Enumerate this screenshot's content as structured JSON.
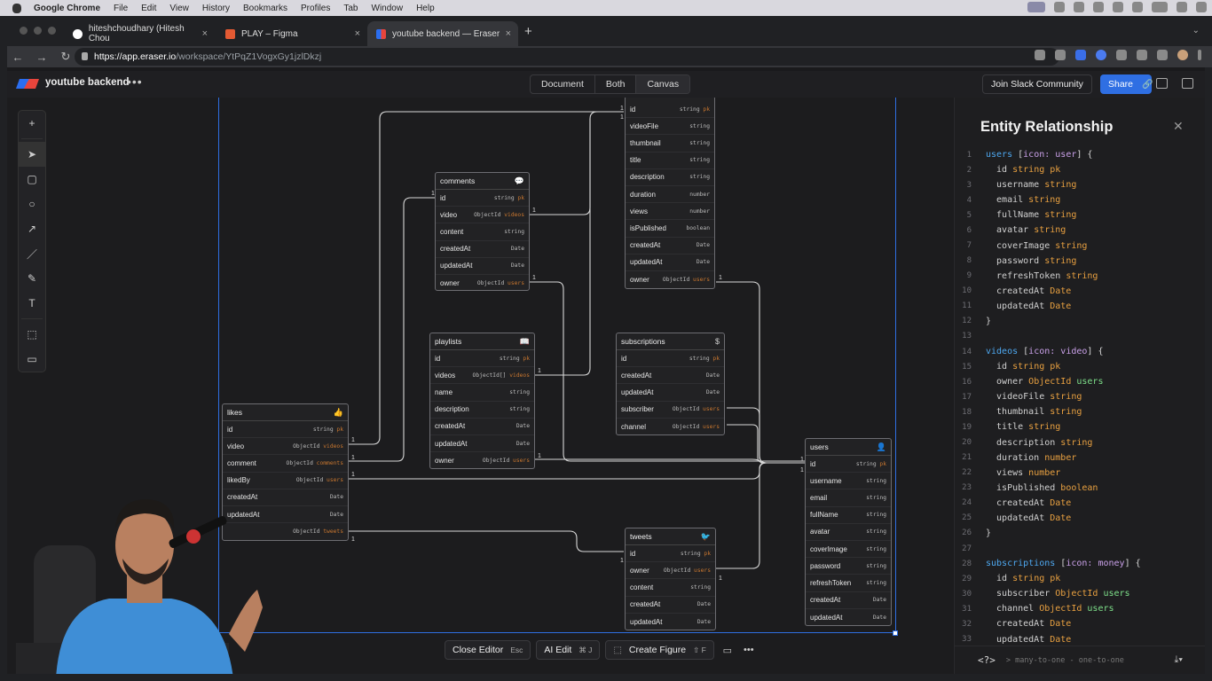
{
  "mac_menu": {
    "app": "Google Chrome",
    "items": [
      "File",
      "Edit",
      "View",
      "History",
      "Bookmarks",
      "Profiles",
      "Tab",
      "Window",
      "Help"
    ]
  },
  "browser": {
    "tabs": [
      {
        "title": "hiteshchoudhary (Hitesh Chou",
        "favicon_color": "#ffffff"
      },
      {
        "title": "PLAY – Figma",
        "favicon_color": "#e45a33"
      },
      {
        "title": "youtube backend — Eraser",
        "favicon_color": "#2b6ef0"
      }
    ],
    "url_host": "https://app.eraser.io",
    "url_path": "/workspace/YtPqZ1VogxGy1jzlDkzj"
  },
  "app": {
    "doc_title": "youtube backend",
    "more": "•••",
    "views": [
      "Document",
      "Both",
      "Canvas"
    ],
    "join_slack": "Join Slack Community",
    "share": "Share"
  },
  "bottom_bar": {
    "close_editor": "Close Editor",
    "close_editor_key": "Esc",
    "ai_edit": "AI Edit",
    "ai_edit_key": "⌘ J",
    "create_figure": "Create Figure",
    "create_figure_key": "⇧ F"
  },
  "entities": {
    "videos": {
      "title": "",
      "rows": [
        {
          "f": "id",
          "t": "string",
          "x": "pk"
        },
        {
          "f": "videoFile",
          "t": "string",
          "x": ""
        },
        {
          "f": "thumbnail",
          "t": "string",
          "x": ""
        },
        {
          "f": "title",
          "t": "string",
          "x": ""
        },
        {
          "f": "description",
          "t": "string",
          "x": ""
        },
        {
          "f": "duration",
          "t": "number",
          "x": ""
        },
        {
          "f": "views",
          "t": "number",
          "x": ""
        },
        {
          "f": "isPublished",
          "t": "boolean",
          "x": ""
        },
        {
          "f": "createdAt",
          "t": "Date",
          "x": ""
        },
        {
          "f": "updatedAt",
          "t": "Date",
          "x": ""
        },
        {
          "f": "owner",
          "t": "ObjectId",
          "x": "users"
        }
      ]
    },
    "comments": {
      "title": "comments",
      "rows": [
        {
          "f": "id",
          "t": "string",
          "x": "pk"
        },
        {
          "f": "video",
          "t": "ObjectId",
          "x": "videos"
        },
        {
          "f": "content",
          "t": "string",
          "x": ""
        },
        {
          "f": "createdAt",
          "t": "Date",
          "x": ""
        },
        {
          "f": "updatedAt",
          "t": "Date",
          "x": ""
        },
        {
          "f": "owner",
          "t": "ObjectId",
          "x": "users"
        }
      ]
    },
    "playlists": {
      "title": "playlists",
      "rows": [
        {
          "f": "id",
          "t": "string",
          "x": "pk"
        },
        {
          "f": "videos",
          "t": "ObjectId[]",
          "x": "videos"
        },
        {
          "f": "name",
          "t": "string",
          "x": ""
        },
        {
          "f": "description",
          "t": "string",
          "x": ""
        },
        {
          "f": "createdAt",
          "t": "Date",
          "x": ""
        },
        {
          "f": "updatedAt",
          "t": "Date",
          "x": ""
        },
        {
          "f": "owner",
          "t": "ObjectId",
          "x": "users"
        }
      ]
    },
    "subscriptions": {
      "title": "subscriptions",
      "rows": [
        {
          "f": "id",
          "t": "string",
          "x": "pk"
        },
        {
          "f": "createdAt",
          "t": "Date",
          "x": ""
        },
        {
          "f": "updatedAt",
          "t": "Date",
          "x": ""
        },
        {
          "f": "subscriber",
          "t": "ObjectId",
          "x": "users"
        },
        {
          "f": "channel",
          "t": "ObjectId",
          "x": "users"
        }
      ]
    },
    "likes": {
      "title": "likes",
      "rows": [
        {
          "f": "id",
          "t": "string",
          "x": "pk"
        },
        {
          "f": "video",
          "t": "ObjectId",
          "x": "videos"
        },
        {
          "f": "comment",
          "t": "ObjectId",
          "x": "comments"
        },
        {
          "f": "likedBy",
          "t": "ObjectId",
          "x": "users"
        },
        {
          "f": "createdAt",
          "t": "Date",
          "x": ""
        },
        {
          "f": "updatedAt",
          "t": "Date",
          "x": ""
        },
        {
          "f": "",
          "t": "ObjectId",
          "x": "tweets"
        }
      ]
    },
    "users": {
      "title": "users",
      "rows": [
        {
          "f": "id",
          "t": "string",
          "x": "pk"
        },
        {
          "f": "username",
          "t": "string",
          "x": ""
        },
        {
          "f": "email",
          "t": "string",
          "x": ""
        },
        {
          "f": "fullName",
          "t": "string",
          "x": ""
        },
        {
          "f": "avatar",
          "t": "string",
          "x": ""
        },
        {
          "f": "coverImage",
          "t": "string",
          "x": ""
        },
        {
          "f": "password",
          "t": "string",
          "x": ""
        },
        {
          "f": "refreshToken",
          "t": "string",
          "x": ""
        },
        {
          "f": "createdAt",
          "t": "Date",
          "x": ""
        },
        {
          "f": "updatedAt",
          "t": "Date",
          "x": ""
        }
      ]
    },
    "tweets": {
      "title": "tweets",
      "rows": [
        {
          "f": "id",
          "t": "string",
          "x": "pk"
        },
        {
          "f": "owner",
          "t": "ObjectId",
          "x": "users"
        },
        {
          "f": "content",
          "t": "string",
          "x": ""
        },
        {
          "f": "createdAt",
          "t": "Date",
          "x": ""
        },
        {
          "f": "updatedAt",
          "t": "Date",
          "x": ""
        }
      ]
    }
  },
  "cardinality_label": "1",
  "side_panel": {
    "title": "Entity Relationship",
    "footer_tag": "<?>",
    "footer_hint": "> many-to-one - one-to-one",
    "code": [
      {
        "n": "1",
        "a": "users",
        "b": " [icon: user] {",
        "k": "hdr"
      },
      {
        "n": "2",
        "a": "id",
        "b": "string",
        "c": "pk",
        "k": "field"
      },
      {
        "n": "3",
        "a": "username",
        "b": "string",
        "k": "field"
      },
      {
        "n": "4",
        "a": "email",
        "b": "string",
        "k": "field"
      },
      {
        "n": "5",
        "a": "fullName",
        "b": "string",
        "k": "field"
      },
      {
        "n": "6",
        "a": "avatar",
        "b": "string",
        "k": "field"
      },
      {
        "n": "7",
        "a": "coverImage",
        "b": "string",
        "k": "field"
      },
      {
        "n": "8",
        "a": "password",
        "b": "string",
        "k": "field"
      },
      {
        "n": "9",
        "a": "refreshToken",
        "b": "string",
        "k": "field"
      },
      {
        "n": "10",
        "a": "createdAt",
        "b": "Date",
        "k": "field"
      },
      {
        "n": "11",
        "a": "updatedAt",
        "b": "Date",
        "k": "field"
      },
      {
        "n": "12",
        "a": "}",
        "k": "close"
      },
      {
        "n": "13",
        "a": "",
        "k": "blank"
      },
      {
        "n": "14",
        "a": "videos",
        "b": " [icon: video] {",
        "k": "hdr"
      },
      {
        "n": "15",
        "a": "id",
        "b": "string",
        "c": "pk",
        "k": "field"
      },
      {
        "n": "16",
        "a": "owner",
        "b": "ObjectId",
        "c": "users",
        "k": "ref"
      },
      {
        "n": "17",
        "a": "videoFile",
        "b": "string",
        "k": "field"
      },
      {
        "n": "18",
        "a": "thumbnail",
        "b": "string",
        "k": "field"
      },
      {
        "n": "19",
        "a": "title",
        "b": "string",
        "k": "field"
      },
      {
        "n": "20",
        "a": "description",
        "b": "string",
        "k": "field"
      },
      {
        "n": "21",
        "a": "duration",
        "b": "number",
        "k": "field"
      },
      {
        "n": "22",
        "a": "views",
        "b": "number",
        "k": "field"
      },
      {
        "n": "23",
        "a": "isPublished",
        "b": "boolean",
        "k": "field"
      },
      {
        "n": "24",
        "a": "createdAt",
        "b": "Date",
        "k": "field"
      },
      {
        "n": "25",
        "a": "updatedAt",
        "b": "Date",
        "k": "field"
      },
      {
        "n": "26",
        "a": "}",
        "k": "close"
      },
      {
        "n": "27",
        "a": "",
        "k": "blank"
      },
      {
        "n": "28",
        "a": "subscriptions",
        "b": " [icon: money] {",
        "k": "hdr"
      },
      {
        "n": "29",
        "a": "id",
        "b": "string",
        "c": "pk",
        "k": "field"
      },
      {
        "n": "30",
        "a": "subscriber",
        "b": "ObjectId",
        "c": "users",
        "k": "ref"
      },
      {
        "n": "31",
        "a": "channel",
        "b": "ObjectId",
        "c": "users",
        "k": "ref"
      },
      {
        "n": "32",
        "a": "createdAt",
        "b": "Date",
        "k": "field"
      },
      {
        "n": "33",
        "a": "updatedAt",
        "b": "Date",
        "k": "field"
      }
    ]
  }
}
